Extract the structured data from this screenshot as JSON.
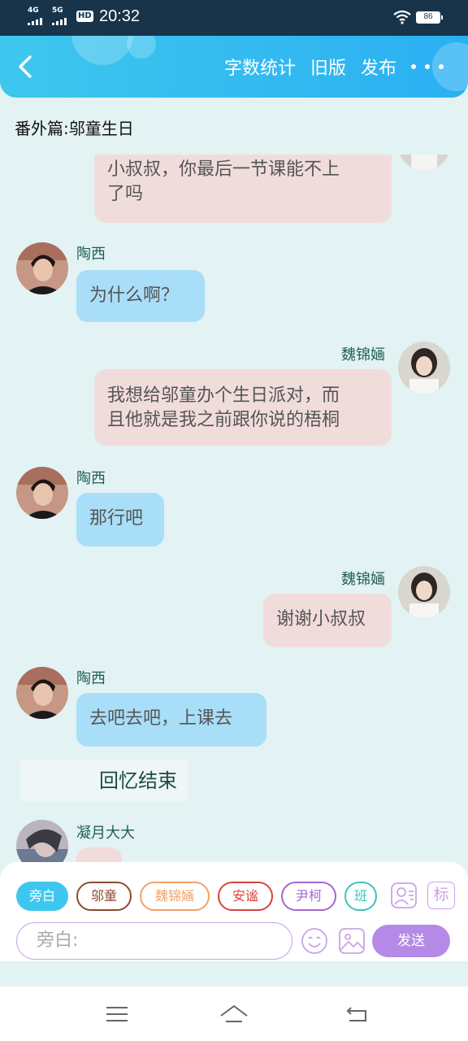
{
  "status_bar": {
    "net1": "4G",
    "net2": "5G",
    "hd": "HD",
    "time": "20:32",
    "battery": "86"
  },
  "header": {
    "actions": [
      "字数统计",
      "旧版",
      "发布"
    ]
  },
  "chapter_title": "番外篇:邬童生日",
  "messages": [
    {
      "side": "right",
      "text_lines": [
        "小叔叔，你最后一节课能不上",
        "了吗"
      ]
    },
    {
      "side": "left",
      "name": "陶西",
      "text": "为什么啊？"
    },
    {
      "side": "right",
      "name": "魏锦婳",
      "text_lines": [
        "我想给邬童办个生日派对，而",
        "且他就是我之前跟你说的梧桐"
      ]
    },
    {
      "side": "left",
      "name": "陶西",
      "text": "那行吧"
    },
    {
      "side": "right",
      "name": "魏锦婳",
      "text": "谢谢小叔叔"
    },
    {
      "side": "left",
      "name": "陶西",
      "text": "去吧去吧，上课去"
    },
    {
      "type": "narration",
      "text": "回忆结束"
    },
    {
      "side": "left",
      "name": "凝月大大",
      "text": ""
    }
  ],
  "roles": [
    {
      "label": "旁白",
      "color": "#3ec7ee",
      "active": true
    },
    {
      "label": "邬童",
      "color": "#8a4b2f"
    },
    {
      "label": "魏锦婳",
      "color": "#f0a26a"
    },
    {
      "label": "安谧",
      "color": "#d9433a"
    },
    {
      "label": "尹柯",
      "color": "#a267d4"
    },
    {
      "label": "班",
      "color": "#3cc3bb"
    }
  ],
  "input": {
    "placeholder": "旁白:"
  },
  "send_label": "发送",
  "colors": {
    "accent": "#3ec7ee",
    "send": "#b48ae6",
    "left_bubble": "#a9def8",
    "right_bubble": "#f1dcdc"
  }
}
